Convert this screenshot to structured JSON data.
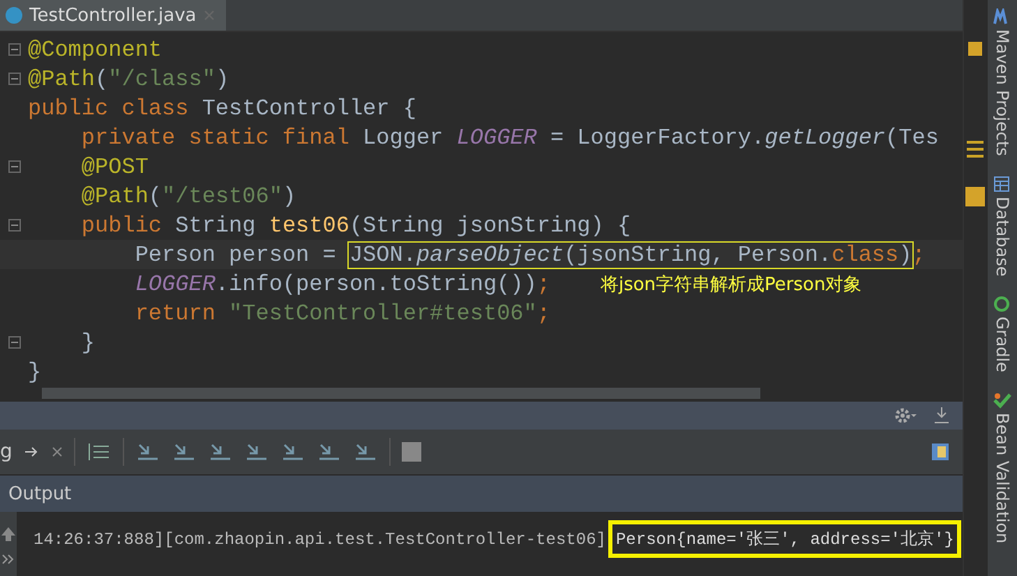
{
  "editor_tab": {
    "title": "TestController.java",
    "selected": true
  },
  "code_lines": [
    {
      "fold": true,
      "current": false,
      "tokens": [
        {
          "text": "@Component",
          "kind": "ann"
        }
      ]
    },
    {
      "fold": true,
      "current": false,
      "tokens": [
        {
          "text": "@Path",
          "kind": "ann"
        },
        {
          "text": "(",
          "kind": "plain"
        },
        {
          "text": "\"/class\"",
          "kind": "str"
        },
        {
          "text": ")",
          "kind": "plain"
        }
      ]
    },
    {
      "fold": false,
      "current": false,
      "tokens": [
        {
          "text": "public class ",
          "kind": "kw"
        },
        {
          "text": "TestController {",
          "kind": "plain"
        }
      ]
    },
    {
      "fold": false,
      "current": false,
      "tokens": [
        {
          "text": "    private static final ",
          "kind": "kw"
        },
        {
          "text": "Logger ",
          "kind": "plain"
        },
        {
          "text": "LOGGER",
          "kind": "field"
        },
        {
          "text": " = LoggerFactory.",
          "kind": "plain"
        },
        {
          "text": "getLogger",
          "kind": "method"
        },
        {
          "text": "(Tes",
          "kind": "plain"
        }
      ]
    },
    {
      "fold": true,
      "current": false,
      "tokens": [
        {
          "text": "    @POST",
          "kind": "ann"
        }
      ]
    },
    {
      "fold": false,
      "current": false,
      "tokens": [
        {
          "text": "    @Path",
          "kind": "ann"
        },
        {
          "text": "(",
          "kind": "plain"
        },
        {
          "text": "\"/test06\"",
          "kind": "str"
        },
        {
          "text": ")",
          "kind": "plain"
        }
      ]
    },
    {
      "fold": true,
      "current": false,
      "tokens": [
        {
          "text": "    public ",
          "kind": "kw"
        },
        {
          "text": "String ",
          "kind": "plain"
        },
        {
          "text": "test06",
          "kind": "decl"
        },
        {
          "text": "(String jsonString) {",
          "kind": "plain"
        }
      ]
    },
    {
      "fold": false,
      "current": true,
      "tokens": [
        {
          "text": "        Person person = ",
          "kind": "plain"
        },
        {
          "kind": "box",
          "tokens": [
            {
              "text": "JSON.",
              "kind": "plain"
            },
            {
              "text": "parseObject",
              "kind": "method"
            },
            {
              "text": "(jsonString, Person.",
              "kind": "plain"
            },
            {
              "text": "class",
              "kind": "kw"
            },
            {
              "text": ")",
              "kind": "plain"
            }
          ]
        },
        {
          "text": ";",
          "kind": "kw"
        }
      ]
    },
    {
      "fold": false,
      "current": false,
      "tokens": [
        {
          "text": "        LOGGER",
          "kind": "field"
        },
        {
          "text": ".info(person.toString())",
          "kind": "plain"
        },
        {
          "text": ";",
          "kind": "kw"
        }
      ],
      "note": "将json字符串解析成Person对象"
    },
    {
      "fold": false,
      "current": false,
      "tokens": [
        {
          "text": "        return ",
          "kind": "kw"
        },
        {
          "text": "\"TestController#test06\"",
          "kind": "str"
        },
        {
          "text": ";",
          "kind": "kw"
        }
      ]
    },
    {
      "fold": true,
      "current": false,
      "tokens": [
        {
          "text": "    }",
          "kind": "plain"
        }
      ]
    },
    {
      "fold": false,
      "current": false,
      "tokens": [
        {
          "text": "}",
          "kind": "plain"
        }
      ]
    }
  ],
  "run_tab": {
    "title": "g"
  },
  "output": {
    "title": "Output",
    "line": "14:26:37:888][com.zhaopin.api.test.TestController-test06]",
    "result": "Person{name='张三', address='北京'}"
  },
  "tool_windows": [
    {
      "label": "Maven Projects",
      "kind": "maven"
    },
    {
      "label": "Database",
      "kind": "database"
    },
    {
      "label": "Gradle",
      "kind": "gradle"
    },
    {
      "label": "Bean Validation",
      "kind": "bean"
    }
  ]
}
